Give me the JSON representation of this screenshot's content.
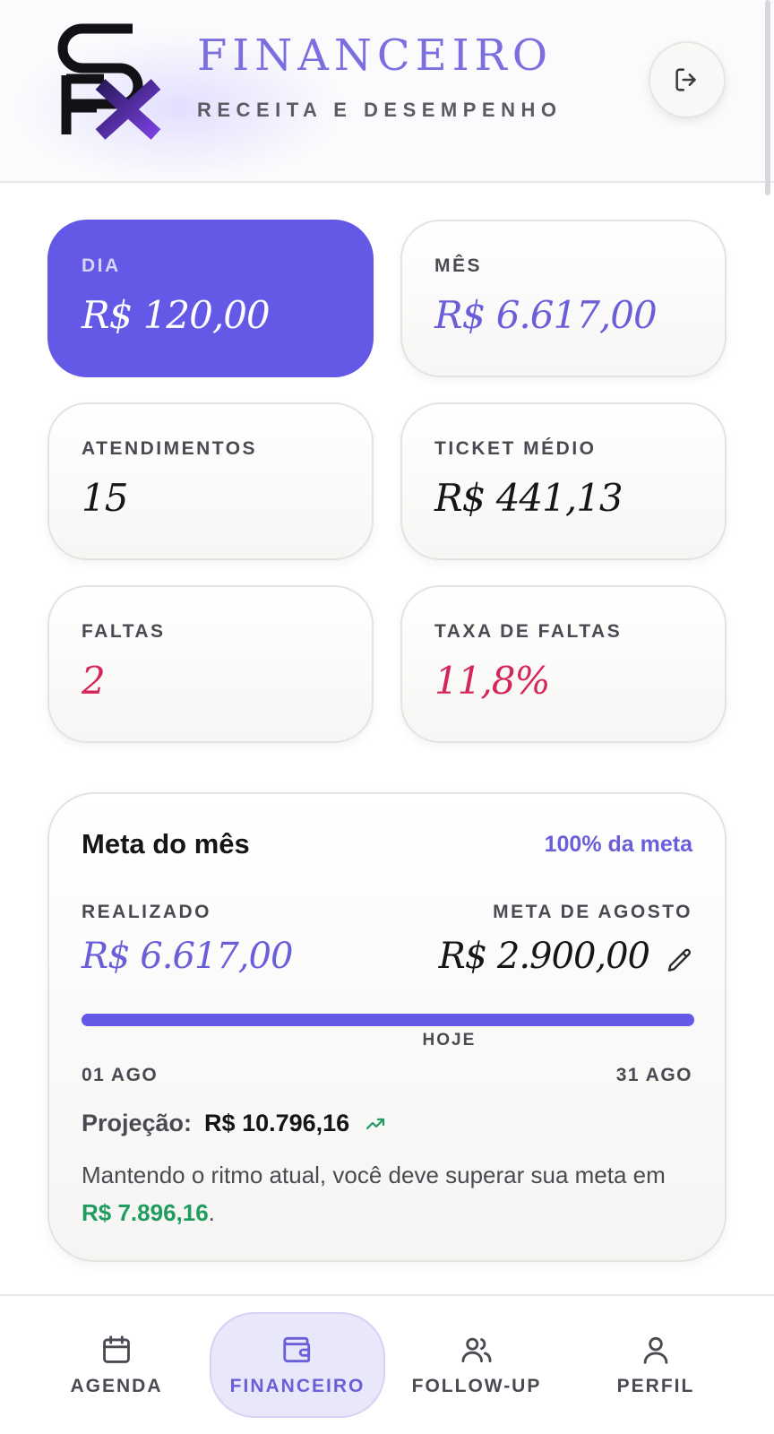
{
  "header": {
    "title": "FINANCEIRO",
    "subtitle": "RECEITA E DESEMPENHO",
    "logo_icon": "sfx-logo",
    "logout_icon": "logout-icon"
  },
  "stats": {
    "dia": {
      "label": "DIA",
      "value": "R$ 120,00"
    },
    "mes": {
      "label": "MÊS",
      "value": "R$ 6.617,00"
    },
    "atendimentos": {
      "label": "ATENDIMENTOS",
      "value": "15"
    },
    "ticket": {
      "label": "TICKET MÉDIO",
      "value": "R$ 441,13"
    },
    "faltas": {
      "label": "FALTAS",
      "value": "2"
    },
    "taxa": {
      "label": "TAXA DE FALTAS",
      "value": "11,8%"
    }
  },
  "meta": {
    "title": "Meta do mês",
    "percent_label": "100% da meta",
    "realizado_label": "REALIZADO",
    "realizado_value": "R$ 6.617,00",
    "meta_label": "META DE AGOSTO",
    "meta_value": "R$ 2.900,00",
    "progress": 1.0,
    "today_position": 0.6,
    "today_label": "HOJE",
    "start_date": "01 AGO",
    "end_date": "31 AGO",
    "projection_label": "Projeção:",
    "projection_value": "R$ 10.796,16",
    "message_prefix": "Mantendo o ritmo atual, você deve superar sua meta em ",
    "message_amount": "R$ 7.896,16",
    "message_suffix": "."
  },
  "nav": {
    "items": [
      {
        "label": "AGENDA",
        "icon": "calendar-icon"
      },
      {
        "label": "FINANCEIRO",
        "icon": "wallet-icon",
        "active": true
      },
      {
        "label": "FOLLOW-UP",
        "icon": "users-icon"
      },
      {
        "label": "PERFIL",
        "icon": "user-icon"
      }
    ]
  },
  "colors": {
    "accent": "#6459e6",
    "accent_text": "#6a5fd8",
    "danger": "#d4265a",
    "success": "#1f9d5f"
  }
}
